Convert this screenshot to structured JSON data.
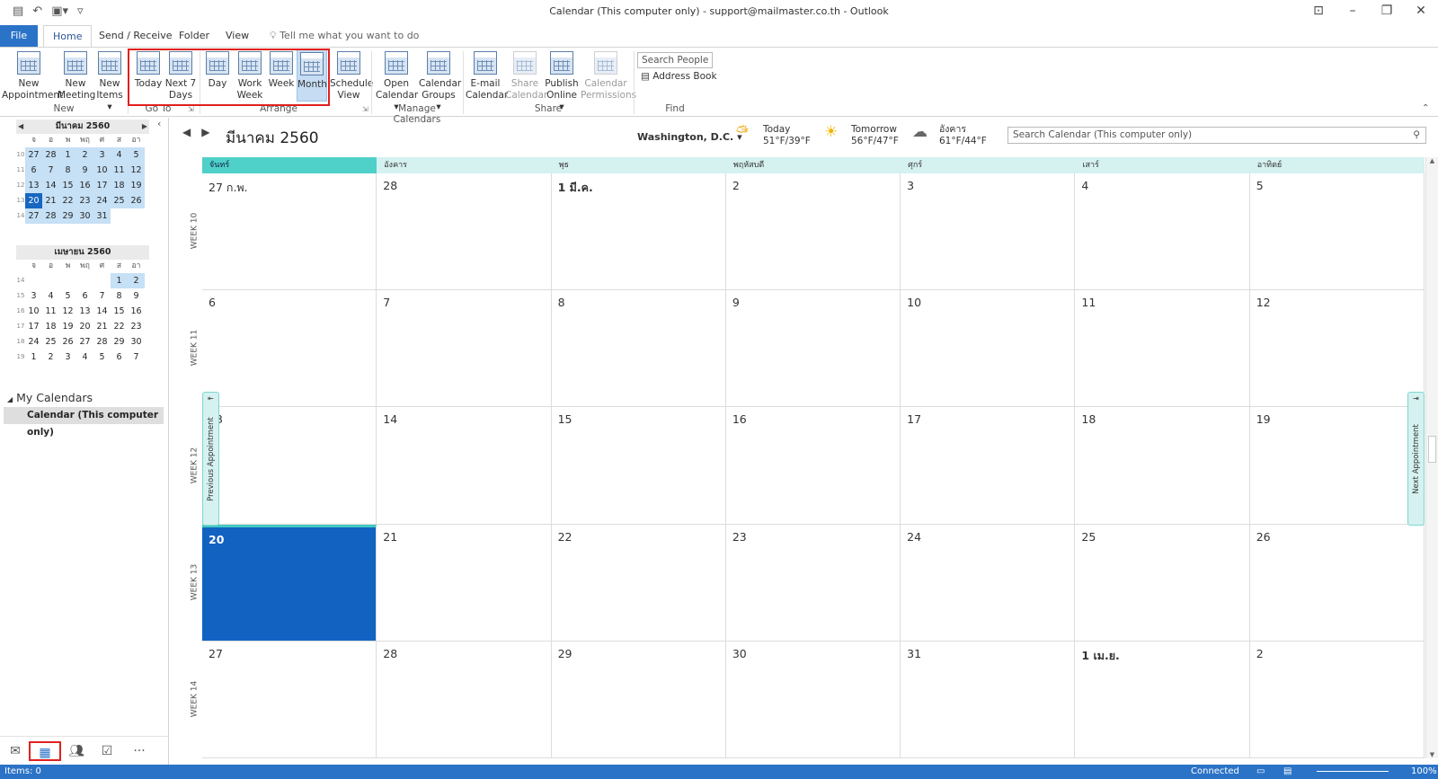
{
  "window": {
    "title": "Calendar (This computer only) - support@mailmaster.co.th  -  Outlook"
  },
  "tabs": {
    "file": "File",
    "home": "Home",
    "send_receive": "Send / Receive",
    "folder": "Folder",
    "view": "View",
    "tell_me": "Tell me what you want to do"
  },
  "ribbon": {
    "new_group": "New",
    "new_appointment": [
      "New",
      "Appointment"
    ],
    "new_meeting": [
      "New",
      "Meeting"
    ],
    "new_items": [
      "New",
      "Items ▾"
    ],
    "goto_group": "Go To",
    "today": "Today",
    "next7": [
      "Next 7",
      "Days"
    ],
    "arrange_group": "Arrange",
    "day": "Day",
    "work_week": [
      "Work",
      "Week"
    ],
    "week": "Week",
    "month": "Month",
    "schedule_view": [
      "Schedule",
      "View"
    ],
    "manage_group": "Manage Calendars",
    "open_calendar": [
      "Open",
      "Calendar ▾"
    ],
    "calendar_groups": [
      "Calendar",
      "Groups ▾"
    ],
    "share_group": "Share",
    "email_calendar": [
      "E-mail",
      "Calendar"
    ],
    "share_calendar": [
      "Share",
      "Calendar"
    ],
    "publish_online": [
      "Publish",
      "Online ▾"
    ],
    "calendar_permissions": [
      "Calendar",
      "Permissions"
    ],
    "find_group": "Find",
    "search_people": "Search People",
    "address_book": "Address Book"
  },
  "minical1": {
    "title": "มีนาคม 2560",
    "dow": [
      "จ",
      "อ",
      "พ",
      "พฤ",
      "ศ",
      "ส",
      "อา"
    ],
    "weeks": [
      {
        "n": "10",
        "days": [
          "27",
          "28",
          "1",
          "2",
          "3",
          "4",
          "5"
        ]
      },
      {
        "n": "11",
        "days": [
          "6",
          "7",
          "8",
          "9",
          "10",
          "11",
          "12"
        ]
      },
      {
        "n": "12",
        "days": [
          "13",
          "14",
          "15",
          "16",
          "17",
          "18",
          "19"
        ]
      },
      {
        "n": "13",
        "days": [
          "20",
          "21",
          "22",
          "23",
          "24",
          "25",
          "26"
        ]
      },
      {
        "n": "14",
        "days": [
          "27",
          "28",
          "29",
          "30",
          "31",
          "",
          ""
        ]
      }
    ]
  },
  "minical2": {
    "title": "เมษายน 2560",
    "dow": [
      "จ",
      "อ",
      "พ",
      "พฤ",
      "ศ",
      "ส",
      "อา"
    ],
    "weeks": [
      {
        "n": "14",
        "days": [
          "",
          "",
          "",
          "",
          "",
          "1",
          "2"
        ]
      },
      {
        "n": "15",
        "days": [
          "3",
          "4",
          "5",
          "6",
          "7",
          "8",
          "9"
        ]
      },
      {
        "n": "16",
        "days": [
          "10",
          "11",
          "12",
          "13",
          "14",
          "15",
          "16"
        ]
      },
      {
        "n": "17",
        "days": [
          "17",
          "18",
          "19",
          "20",
          "21",
          "22",
          "23"
        ]
      },
      {
        "n": "18",
        "days": [
          "24",
          "25",
          "26",
          "27",
          "28",
          "29",
          "30"
        ]
      },
      {
        "n": "19",
        "days": [
          "1",
          "2",
          "3",
          "4",
          "5",
          "6",
          "7"
        ]
      }
    ]
  },
  "folders": {
    "my_calendars": "My Calendars",
    "calendar_item": "Calendar (This computer only)"
  },
  "calendar": {
    "month_title": "มีนาคม 2560",
    "location": "Washington, D.C. ▾",
    "weather": [
      {
        "day": "Today",
        "temp": "51°F/39°F",
        "icon": "partly-cloudy-icon"
      },
      {
        "day": "Tomorrow",
        "temp": "56°F/47°F",
        "icon": "sunny-icon"
      },
      {
        "day": "อังคาร",
        "temp": "61°F/44°F",
        "icon": "cloudy-icon"
      }
    ],
    "search_placeholder": "Search Calendar (This computer only)",
    "weekdays": [
      "จันทร์",
      "อังคาร",
      "พุธ",
      "พฤหัสบดี",
      "ศุกร์",
      "เสาร์",
      "อาทิตย์"
    ],
    "weeks": [
      {
        "label": "WEEK 10",
        "days": [
          "27 ก.พ.",
          "28",
          "1 มี.ค.",
          "2",
          "3",
          "4",
          "5"
        ]
      },
      {
        "label": "WEEK 11",
        "days": [
          "6",
          "7",
          "8",
          "9",
          "10",
          "11",
          "12"
        ]
      },
      {
        "label": "WEEK 12",
        "days": [
          "13",
          "14",
          "15",
          "16",
          "17",
          "18",
          "19"
        ]
      },
      {
        "label": "WEEK 13",
        "days": [
          "20",
          "21",
          "22",
          "23",
          "24",
          "25",
          "26"
        ]
      },
      {
        "label": "WEEK 14",
        "days": [
          "27",
          "28",
          "29",
          "30",
          "31",
          "1 เม.ย.",
          "2"
        ]
      }
    ],
    "previous_appointment": "Previous Appointment",
    "next_appointment": "Next Appointment"
  },
  "status": {
    "items": "Items: 0",
    "connected": "Connected",
    "zoom": "100%"
  },
  "colors": {
    "accent": "#2b73c7",
    "today": "#1262c2",
    "highlight_box": "#e0201f"
  }
}
